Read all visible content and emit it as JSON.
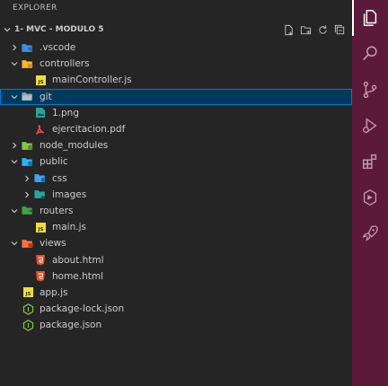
{
  "explorer": {
    "title": "EXPLORER",
    "workspace": "1- MVC - MODULO 5",
    "actions": [
      "new-file-icon",
      "new-folder-icon",
      "refresh-icon",
      "collapse-all-icon"
    ]
  },
  "tree": [
    {
      "label": ".vscode",
      "type": "folder",
      "depth": 0,
      "expanded": false,
      "icon": "vscode-folder-icon",
      "color": "#3794ff"
    },
    {
      "label": "controllers",
      "type": "folder",
      "depth": 0,
      "expanded": true,
      "icon": "controllers-folder-icon",
      "color": "#e8b62b"
    },
    {
      "label": "mainController.js",
      "type": "file",
      "depth": 1,
      "icon": "js-file-icon",
      "color": "#f1dd35"
    },
    {
      "label": "git",
      "type": "folder",
      "depth": 0,
      "expanded": true,
      "icon": "folder-icon",
      "color": "#90a4ae",
      "selected": true
    },
    {
      "label": "1.png",
      "type": "file",
      "depth": 1,
      "icon": "image-file-icon",
      "color": "#26a69a"
    },
    {
      "label": "ejercitacion.pdf",
      "type": "file",
      "depth": 1,
      "icon": "pdf-file-icon",
      "color": "#ef5350"
    },
    {
      "label": "node_modules",
      "type": "folder",
      "depth": 0,
      "expanded": false,
      "icon": "node-modules-folder-icon",
      "color": "#8bc34a"
    },
    {
      "label": "public",
      "type": "folder",
      "depth": 0,
      "expanded": true,
      "icon": "public-folder-icon",
      "color": "#29b6f6"
    },
    {
      "label": "css",
      "type": "folder",
      "depth": 1,
      "expanded": false,
      "icon": "css-folder-icon",
      "color": "#42a5f5"
    },
    {
      "label": "images",
      "type": "folder",
      "depth": 1,
      "expanded": false,
      "icon": "images-folder-icon",
      "color": "#26a69a"
    },
    {
      "label": "routers",
      "type": "folder",
      "depth": 0,
      "expanded": true,
      "icon": "routers-folder-icon",
      "color": "#43a047"
    },
    {
      "label": "main.js",
      "type": "file",
      "depth": 1,
      "icon": "js-file-icon",
      "color": "#f1dd35"
    },
    {
      "label": "views",
      "type": "folder",
      "depth": 0,
      "expanded": true,
      "icon": "views-folder-icon",
      "color": "#ff7043"
    },
    {
      "label": "about.html",
      "type": "file",
      "depth": 1,
      "icon": "html-file-icon",
      "color": "#e44d26"
    },
    {
      "label": "home.html",
      "type": "file",
      "depth": 1,
      "icon": "html-file-icon",
      "color": "#e44d26"
    },
    {
      "label": "app.js",
      "type": "file",
      "depth": 0,
      "icon": "js-file-icon",
      "color": "#f1dd35"
    },
    {
      "label": "package-lock.json",
      "type": "file",
      "depth": 0,
      "icon": "nodejs-file-icon",
      "color": "#8bc34a"
    },
    {
      "label": "package.json",
      "type": "file",
      "depth": 0,
      "icon": "nodejs-file-icon",
      "color": "#8bc34a"
    }
  ],
  "activity_bar": {
    "background": "#5c1a3a",
    "items": [
      "explorer-icon",
      "search-icon",
      "source-control-icon",
      "run-debug-icon",
      "extensions-icon",
      "remote-explorer-icon",
      "rocket-icon"
    ]
  }
}
